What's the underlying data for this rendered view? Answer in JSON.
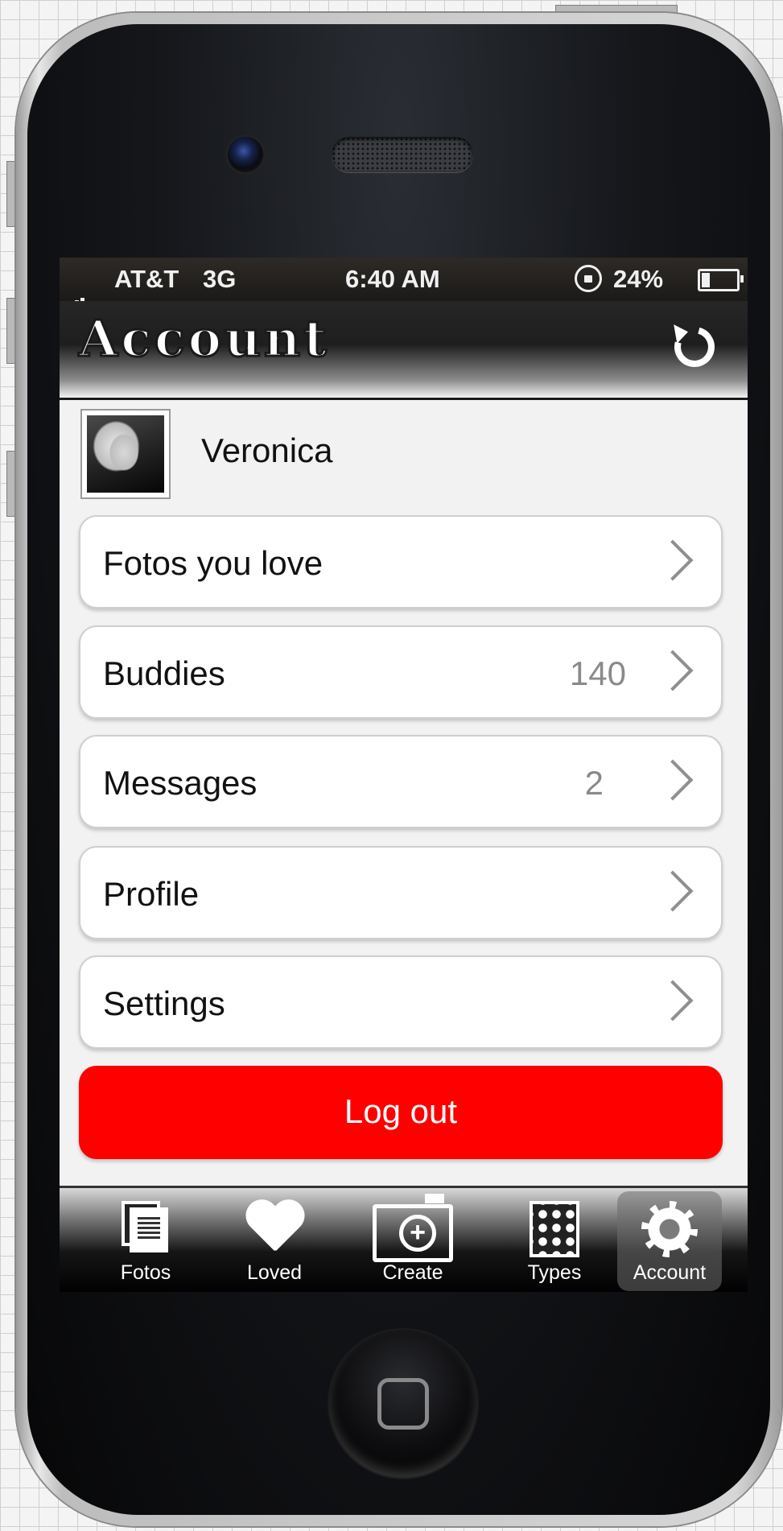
{
  "status_bar": {
    "carrier": "AT&T",
    "network": "3G",
    "time": "6:40 AM",
    "battery": "24%",
    "icons": [
      "signal-icon",
      "rotation-lock-icon",
      "battery-icon"
    ]
  },
  "navbar": {
    "title": "Account",
    "refresh_icon": "refresh-icon"
  },
  "user": {
    "name": "Veronica"
  },
  "menu": [
    {
      "label": "Fotos you love",
      "count": ""
    },
    {
      "label": "Buddies",
      "count": "140"
    },
    {
      "label": "Messages",
      "count": "2"
    },
    {
      "label": "Profile",
      "count": ""
    },
    {
      "label": "Settings",
      "count": ""
    }
  ],
  "logout": {
    "label": "Log out",
    "color": "#ff0000"
  },
  "tabs": [
    {
      "label": "Fotos",
      "icon": "photos-icon"
    },
    {
      "label": "Loved",
      "icon": "heart-icon"
    },
    {
      "label": "Create",
      "icon": "camera-icon"
    },
    {
      "label": "Types",
      "icon": "grid-icon"
    },
    {
      "label": "Account",
      "icon": "gear-icon",
      "active": true
    }
  ]
}
